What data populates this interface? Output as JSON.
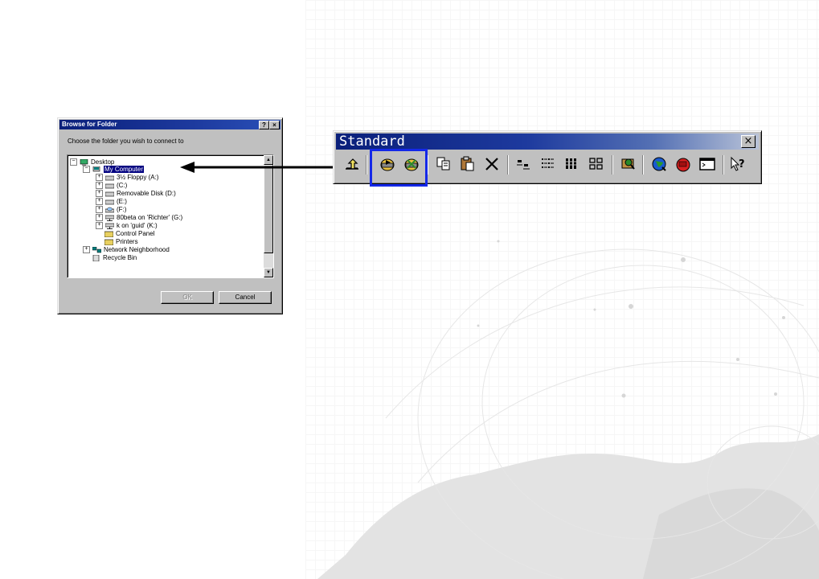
{
  "dialog": {
    "title": "Browse for Folder",
    "help_button": "?",
    "close_button": "×",
    "prompt": "Choose the folder you wish to connect to",
    "tree": [
      {
        "label": "Desktop",
        "expander": "−"
      },
      {
        "label": "My Computer",
        "expander": "−",
        "selected": true
      },
      {
        "label": "3½ Floppy (A:)",
        "expander": "+"
      },
      {
        "label": "(C:)",
        "expander": "+"
      },
      {
        "label": "Removable Disk (D:)",
        "expander": "+"
      },
      {
        "label": "(E:)",
        "expander": "+"
      },
      {
        "label": "(F:)",
        "expander": "+"
      },
      {
        "label": "80beta on 'Richter' (G:)",
        "expander": "+"
      },
      {
        "label": "k on 'guid' (K:)",
        "expander": "+"
      },
      {
        "label": "Control Panel",
        "expander": ""
      },
      {
        "label": "Printers",
        "expander": ""
      },
      {
        "label": "Network Neighborhood",
        "expander": "+"
      },
      {
        "label": "Recycle Bin",
        "expander": ""
      }
    ],
    "ok_label": "OK",
    "cancel_label": "Cancel"
  },
  "toolbar": {
    "title": "Standard",
    "close_label": "×",
    "tools": [
      {
        "icon": "up-folder-icon"
      },
      {
        "icon": "map-network-drive-icon"
      },
      {
        "icon": "disconnect-network-drive-icon"
      },
      {
        "icon": "copy-icon"
      },
      {
        "icon": "paste-icon"
      },
      {
        "icon": "delete-icon"
      },
      {
        "icon": "large-icons-icon"
      },
      {
        "icon": "list-icon"
      },
      {
        "icon": "details-icon"
      },
      {
        "icon": "small-icons-icon"
      },
      {
        "icon": "find-icon"
      },
      {
        "icon": "internet-icon"
      },
      {
        "icon": "programs-icon"
      },
      {
        "icon": "command-prompt-icon"
      },
      {
        "icon": "whats-this-help-icon"
      }
    ],
    "help_glyph": "?"
  },
  "colors": {
    "titlebar": "#0a1f7a",
    "highlight_box": "#1428e8",
    "selection": "#000080"
  }
}
